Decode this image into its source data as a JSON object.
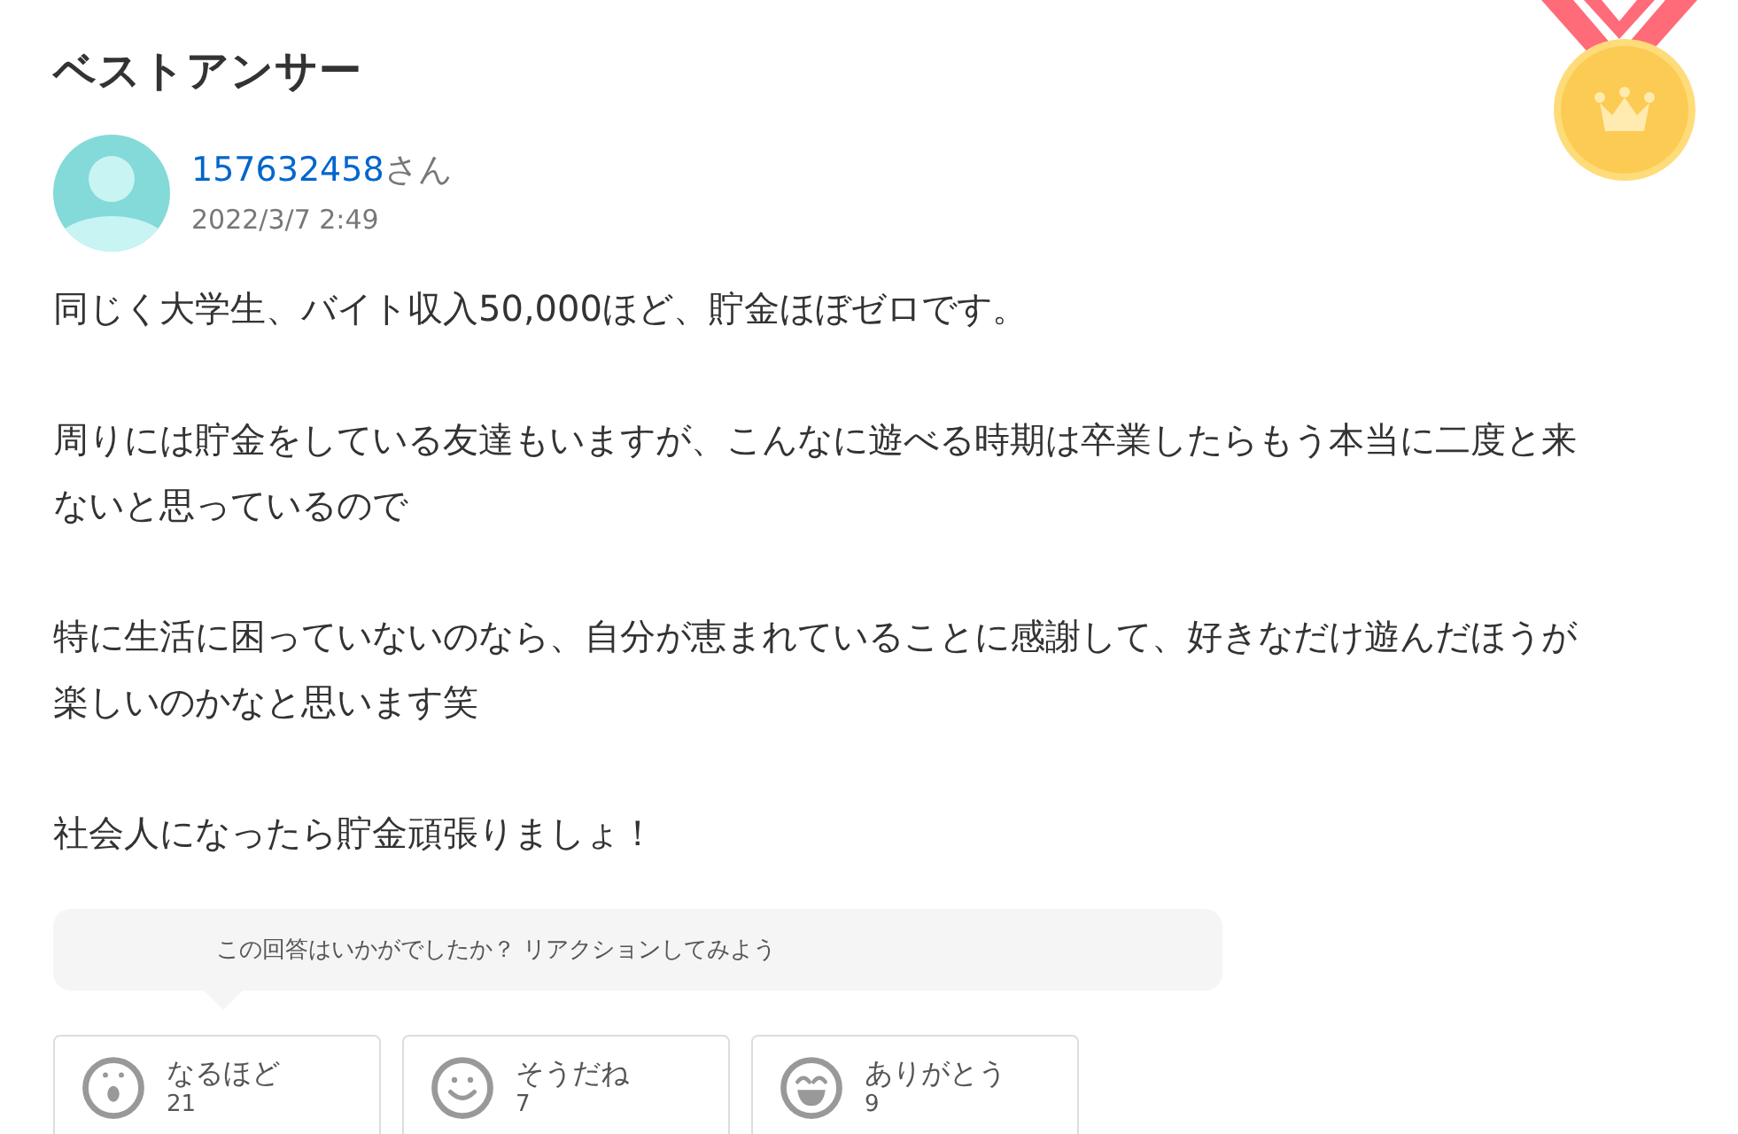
{
  "heading": "ベストアンサー",
  "author": {
    "name": "157632458",
    "suffix": "さん",
    "date": "2022/3/7 2:49"
  },
  "paragraphs": [
    "同じく大学生、バイト収入50,000ほど、貯金ほぼゼロです。",
    "周りには貯金をしている友達もいますが、こんなに遊べる時期は卒業したらもう本当に二度と来ないと思っているので",
    "特に生活に困っていないのなら、自分が恵まれていることに感謝して、好きなだけ遊んだほうが楽しいのかなと思います笑",
    "社会人になったら貯金頑張りましょ！"
  ],
  "prompt": "この回答はいかがでしたか？ リアクションしてみよう",
  "reactions": [
    {
      "kind": "surprised",
      "label": "なるほど",
      "count": "21"
    },
    {
      "kind": "smile",
      "label": "そうだね",
      "count": "7"
    },
    {
      "kind": "grin",
      "label": "ありがとう",
      "count": "9"
    }
  ]
}
